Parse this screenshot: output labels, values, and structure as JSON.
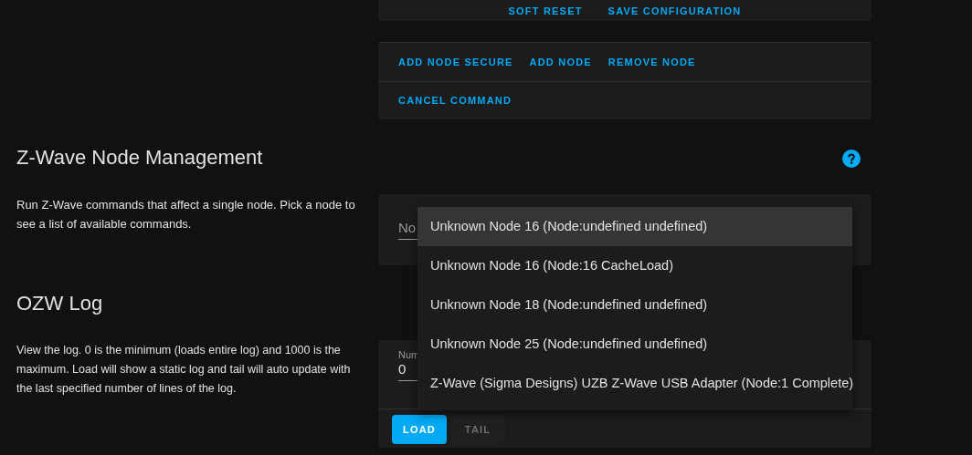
{
  "top_card": {
    "buttons": [
      "SOFT RESET",
      "SAVE CONFIGURATION"
    ]
  },
  "controller_card": {
    "button_rows": [
      [
        "ADD NODE SECURE",
        "ADD NODE",
        "REMOVE NODE"
      ],
      [
        "CANCEL COMMAND"
      ]
    ]
  },
  "node_management": {
    "title": "Z-Wave Node Management",
    "description": "Run Z-Wave commands that affect a single node. Pick a node to see a list of available commands.",
    "node_select": {
      "label": "No"
    },
    "dropdown": {
      "options": [
        {
          "label": "Unknown Node 16 (Node:undefined undefined)",
          "selected": true
        },
        {
          "label": "Unknown Node 16 (Node:16 CacheLoad)",
          "selected": false
        },
        {
          "label": "Unknown Node 18 (Node:undefined undefined)",
          "selected": false
        },
        {
          "label": "Unknown Node 25 (Node:undefined undefined)",
          "selected": false
        },
        {
          "label": "Z-Wave (Sigma Designs) UZB Z-Wave USB Adapter (Node:1 Complete)",
          "selected": false
        }
      ]
    }
  },
  "ozw_log": {
    "title": "OZW Log",
    "description": "View the log. 0 is the minimum (loads entire log) and 1000 is the maximum. Load will show a static log and tail will auto update with the last specified number of lines of the log.",
    "lines_field": {
      "label": "Num",
      "value": "0"
    },
    "buttons": [
      {
        "label": "LOAD",
        "disabled": false
      },
      {
        "label": "TAIL",
        "disabled": true
      }
    ]
  }
}
